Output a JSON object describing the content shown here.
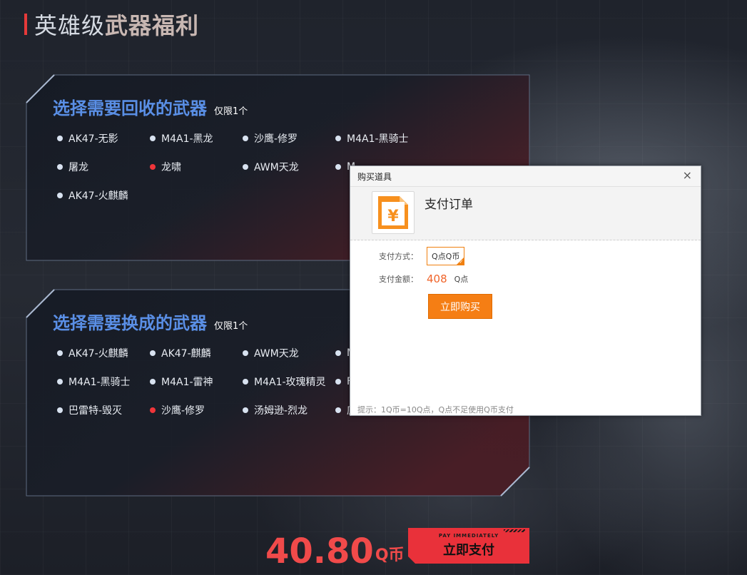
{
  "header": {
    "title_normal": "英雄级",
    "title_bold": "武器福利"
  },
  "recycle_panel": {
    "heading": "选择需要回收的武器",
    "limit": "仅限1个",
    "options": [
      {
        "label": "AK47-无影",
        "selected": false
      },
      {
        "label": "M4A1-黑龙",
        "selected": false
      },
      {
        "label": "沙鹰-修罗",
        "selected": false
      },
      {
        "label": "M4A1-黑骑士",
        "selected": false
      },
      {
        "label": "屠龙",
        "selected": false
      },
      {
        "label": "龙啸",
        "selected": true
      },
      {
        "label": "AWM天龙",
        "selected": false
      },
      {
        "label": "M",
        "selected": false
      },
      {
        "label": "AK47-火麒麟",
        "selected": false
      }
    ]
  },
  "exchange_panel": {
    "heading": "选择需要换成的武器",
    "limit": "仅限1个",
    "options": [
      {
        "label": "AK47-火麒麟",
        "selected": false
      },
      {
        "label": "AK47-麒麟",
        "selected": false
      },
      {
        "label": "AWM天龙",
        "selected": false
      },
      {
        "label": "M",
        "selected": false
      },
      {
        "label": "M4A1-黑骑士",
        "selected": false
      },
      {
        "label": "M4A1-雷神",
        "selected": false
      },
      {
        "label": "M4A1-玫瑰精灵",
        "selected": false
      },
      {
        "label": "F",
        "selected": false
      },
      {
        "label": "巴雷特-毁灭",
        "selected": false
      },
      {
        "label": "沙鹰-修罗",
        "selected": true
      },
      {
        "label": "汤姆逊-烈龙",
        "selected": false
      },
      {
        "label": "庐",
        "selected": false
      }
    ]
  },
  "footer": {
    "price": "40.80",
    "unit": "Q币",
    "pay_en": "PAY IMMEDIATELY",
    "pay_cn": "立即支付"
  },
  "modal": {
    "title": "购买道具",
    "close_symbol": "×",
    "order_title": "支付订单",
    "icon_symbol": "¥",
    "method_label": "支付方式：",
    "method_value": "Q点Q币",
    "amount_label": "支付金额：",
    "amount_value": "408",
    "amount_unit": "Q点",
    "buy_label": "立即购买",
    "tip": "提示：1Q币=10Q点，Q点不足使用Q币支付"
  },
  "colors": {
    "accent_blue": "#5a8fe6",
    "selected_red": "#f0353a",
    "price_red": "#f04a4a",
    "buy_orange": "#f57e14"
  }
}
